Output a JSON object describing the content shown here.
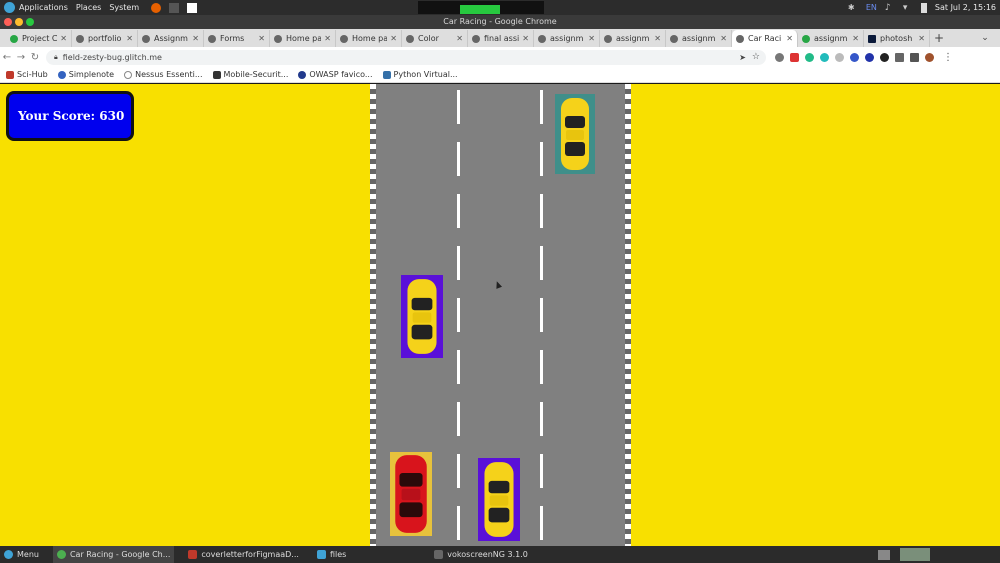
{
  "os": {
    "menu": [
      "Applications",
      "Places",
      "System"
    ],
    "clock": "Sat Jul 2, 15:16",
    "keyboard": "EN"
  },
  "window": {
    "title": "Car Racing - Google Chrome"
  },
  "tabs": [
    {
      "label": "Project C",
      "active": false
    },
    {
      "label": "portfolio",
      "active": false
    },
    {
      "label": "Assignm",
      "active": false
    },
    {
      "label": "Forms",
      "active": false
    },
    {
      "label": "Home pa",
      "active": false
    },
    {
      "label": "Home pa",
      "active": false
    },
    {
      "label": "Color",
      "active": false
    },
    {
      "label": "final assi",
      "active": false
    },
    {
      "label": "assignm",
      "active": false
    },
    {
      "label": "assignm",
      "active": false
    },
    {
      "label": "assignm",
      "active": false
    },
    {
      "label": "Car Raci",
      "active": true
    },
    {
      "label": "assignm",
      "active": false
    },
    {
      "label": "photosh",
      "active": false
    }
  ],
  "address": {
    "url": "field-zesty-bug.glitch.me"
  },
  "bookmarks": [
    "Sci-Hub",
    "Simplenote",
    "Nessus Essenti...",
    "Mobile-Securit...",
    "OWASP favico...",
    "Python Virtual..."
  ],
  "game": {
    "score_label": "Your Score: 630",
    "player_car_color": "#d8141c",
    "enemy_car_color": "#f5d21a",
    "highlight_purple": "#5a10d8",
    "highlight_teal": "#3f8f8a"
  },
  "taskbar": {
    "menu_label": "Menu",
    "items": [
      "Car Racing - Google Ch...",
      "coverletterforFigmaaD...",
      "files",
      "vokoscreenNG 3.1.0"
    ]
  }
}
